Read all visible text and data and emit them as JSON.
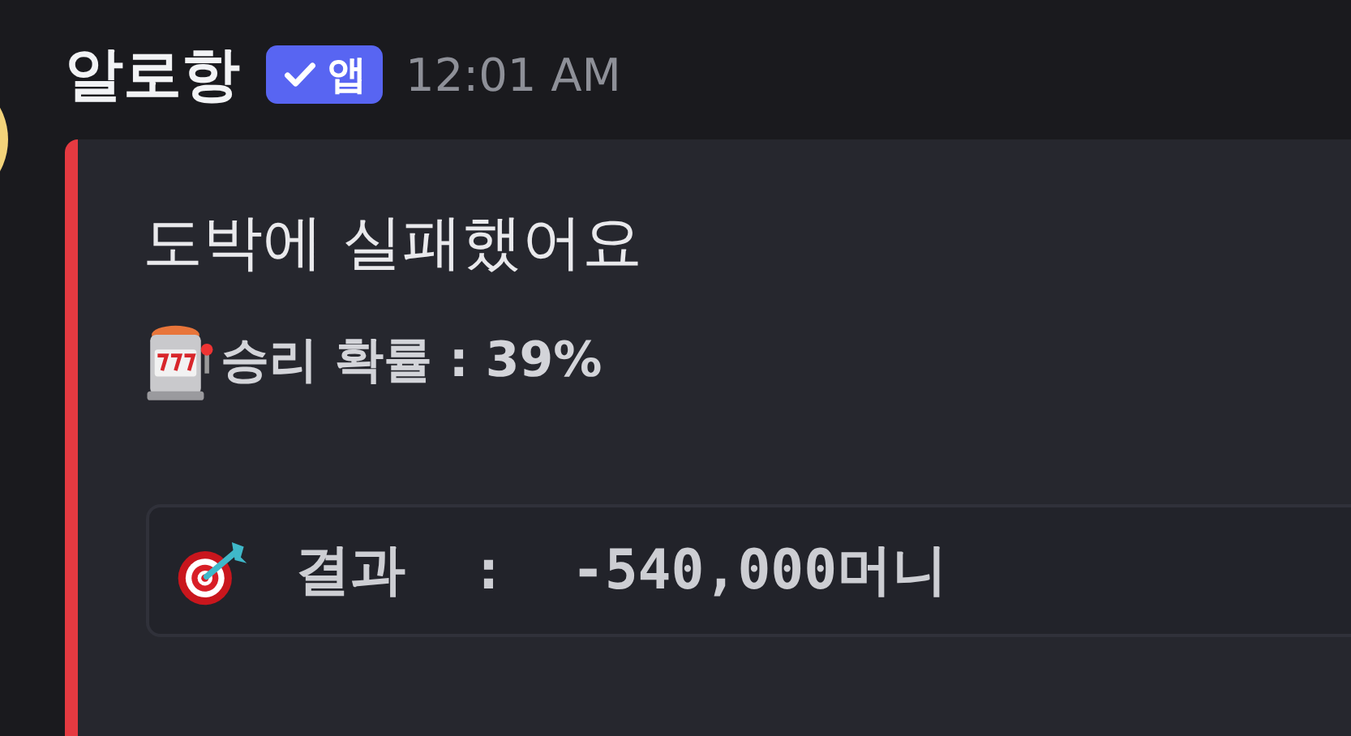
{
  "message": {
    "author": "알로항",
    "badge": {
      "label": "앱",
      "verified": true
    },
    "time": "12:01 AM"
  },
  "embed": {
    "title": "도박에 실패했어요",
    "description": "승리 확률 : 39%",
    "code": "결과  :  -540,000머니"
  }
}
